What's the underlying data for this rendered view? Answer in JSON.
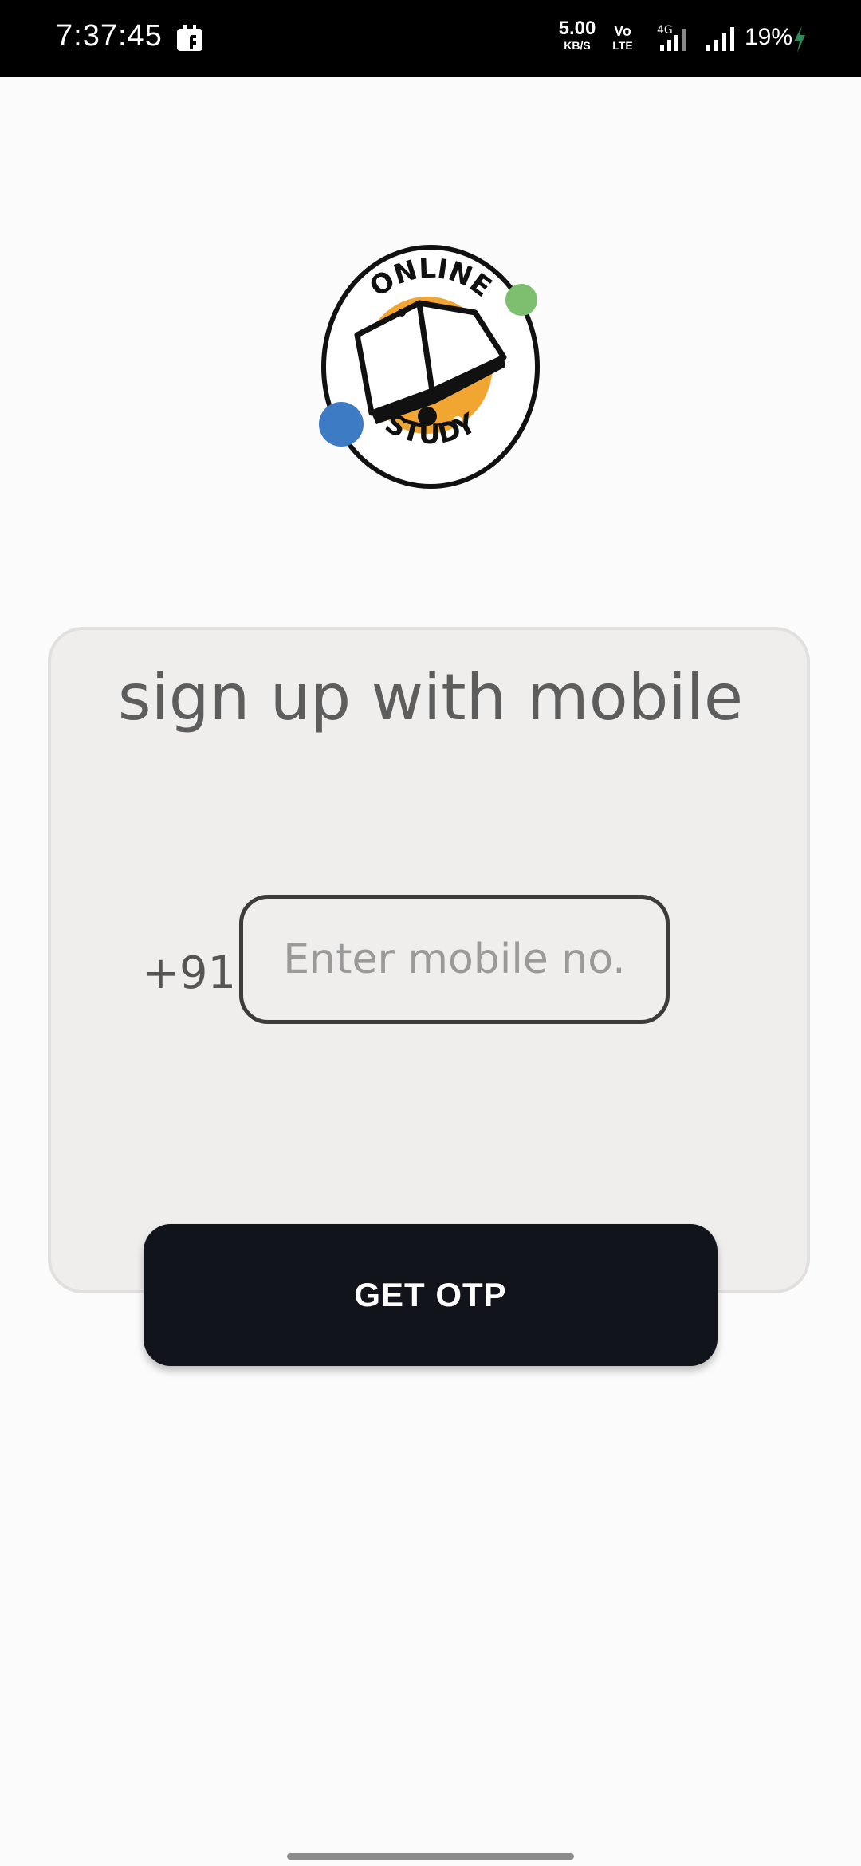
{
  "status_bar": {
    "time": "7:37:45",
    "net_speed_value": "5.00",
    "net_speed_unit": "KB/S",
    "volte_top": "Vo",
    "volte_bottom": "LTE",
    "network_type": "4G",
    "battery": "19%",
    "icons": [
      "notification-app-icon",
      "signal-4g-icon",
      "signal-icon",
      "charging-bolt-icon"
    ]
  },
  "logo": {
    "top_text": "ONLINE",
    "bottom_text": "STUDY",
    "colors": {
      "ring": "#111111",
      "sun": "#f2a632",
      "green_dot": "#7dbf6e",
      "blue_dot": "#3d7bc4"
    }
  },
  "signup": {
    "title": "sign up with mobile",
    "country_code": "+91",
    "mobile_placeholder": "Enter mobile no.",
    "mobile_value": ""
  },
  "actions": {
    "get_otp_label": "GET OTP"
  },
  "colors": {
    "background": "#fbfbfb",
    "card": "#efeeed",
    "button": "#11141a",
    "title_text": "#5d5d5d"
  }
}
